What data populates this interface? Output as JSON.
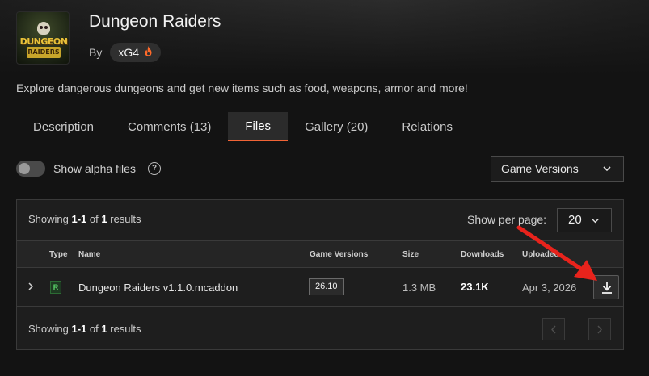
{
  "project": {
    "title": "Dungeon Raiders",
    "by_label": "By",
    "author": "xG4",
    "logo_line1": "DUNGEON",
    "logo_line2": "RAIDERS",
    "description": "Explore dangerous dungeons and get new items such as food, weapons, armor and more!"
  },
  "tabs": [
    {
      "label": "Description"
    },
    {
      "label": "Comments (13)"
    },
    {
      "label": "Files",
      "active": true
    },
    {
      "label": "Gallery (20)"
    },
    {
      "label": "Relations"
    }
  ],
  "filters": {
    "alpha_toggle_label": "Show alpha files",
    "alpha_enabled": false,
    "game_versions_label": "Game Versions"
  },
  "results": {
    "showing_prefix": "Showing",
    "range": "1-1",
    "of_label": "of",
    "total": "1",
    "results_label": "results",
    "per_page_label": "Show per page:",
    "per_page_value": "20"
  },
  "table": {
    "headers": {
      "type": "Type",
      "name": "Name",
      "game_versions": "Game Versions",
      "size": "Size",
      "downloads": "Downloads",
      "uploaded": "Uploaded"
    },
    "rows": [
      {
        "type_badge": "R",
        "name": "Dungeon Raiders v1.1.0.mcaddon",
        "game_version": "26.10",
        "size": "1.3 MB",
        "downloads": "23.1K",
        "uploaded": "Apr 3, 2026"
      }
    ]
  },
  "colors": {
    "accent": "#f16436",
    "annotation_arrow": "#e8231c",
    "release_green": "#5bd46a"
  },
  "icons": {
    "author": "flame-icon",
    "help": "help-icon",
    "download": "download-icon",
    "expand": "chevron-right-icon"
  }
}
